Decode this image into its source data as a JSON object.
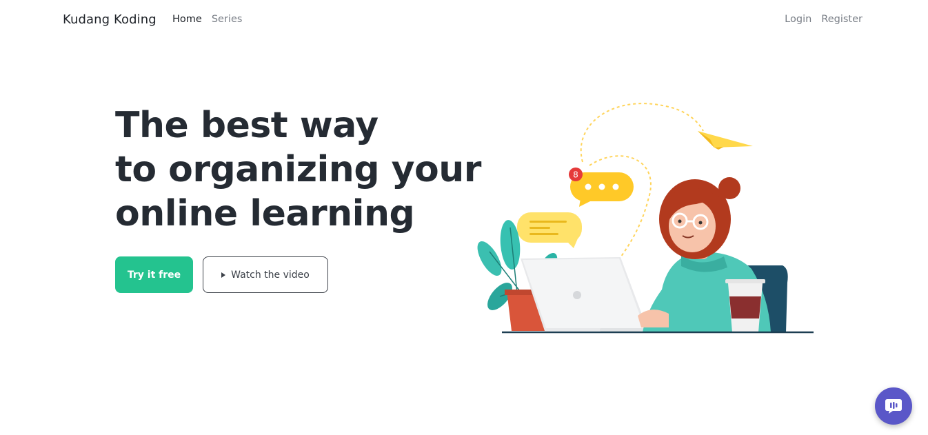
{
  "navbar": {
    "brand": "Kudang Koding",
    "links": [
      {
        "label": "Home",
        "active": true
      },
      {
        "label": "Series",
        "active": false
      }
    ],
    "auth": {
      "login": "Login",
      "register": "Register"
    }
  },
  "hero": {
    "title_lines": [
      "The best way",
      "to organizing your",
      "online learning"
    ],
    "primary_button": "Try it free",
    "secondary_button": "Watch the video",
    "notification_count": "8"
  },
  "colors": {
    "accent": "#24c38f",
    "text_dark": "#252b33",
    "chat_widget": "#5a57c8",
    "illustration_yellow": "#ffcc2f",
    "illustration_teal": "#4fc8b8"
  },
  "icons": {
    "play": "play-icon",
    "chat": "chat-icon",
    "paper_plane": "paper-plane-icon"
  }
}
